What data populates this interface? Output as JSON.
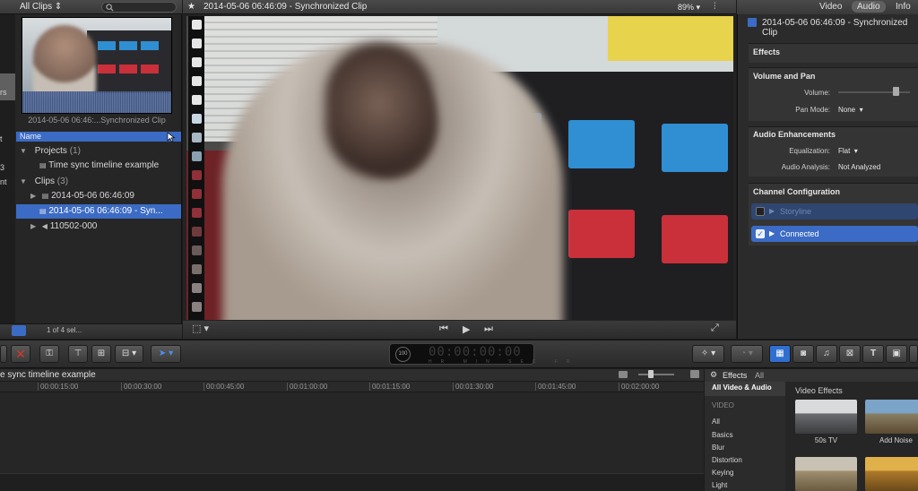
{
  "browser": {
    "filter_label": "All Clips",
    "sidebar_fragments": [
      "rs",
      "t",
      "3",
      "nt"
    ],
    "thumb_label": "2014-05-06 06:46:...Synchronized Clip",
    "column_name": "Name",
    "projects_label": "Projects",
    "projects_count": "(1)",
    "project_item": "Time sync timeline example",
    "clips_label": "Clips",
    "clips_count": "(3)",
    "clip_1": "2014-05-06 06:46:09",
    "clip_2": "2014-05-06 06:46:09 - Syn...",
    "clip_3": "110502-000",
    "selection_count": "1 of 4 sel..."
  },
  "viewer": {
    "title": "2014-05-06 06:46:09 - Synchronized Clip",
    "zoom": "89%"
  },
  "inspector": {
    "tabs": [
      "Video",
      "Audio",
      "Info"
    ],
    "title": "2014-05-06 06:46:09 - Synchronized Clip",
    "effects_header": "Effects",
    "volume_pan_header": "Volume and Pan",
    "volume_label": "Volume:",
    "pan_mode_label": "Pan Mode:",
    "pan_mode_value": "None",
    "enhancements_header": "Audio Enhancements",
    "equalization_label": "Equalization:",
    "equalization_value": "Flat",
    "analysis_label": "Audio Analysis:",
    "analysis_value": "Not Analyzed",
    "channel_header": "Channel Configuration",
    "channel_storyline": "Storyline",
    "channel_connected": "Connected"
  },
  "toolbar": {
    "timecode": "00:00:00:00",
    "timecode_units": "HR MIN SEC FR",
    "percent": "100"
  },
  "timeline": {
    "title": "e sync timeline example",
    "ticks": [
      "00:00:15:00",
      "00:00:30:00",
      "00:00:45:00",
      "00:01:00:00",
      "00:01:15:00",
      "00:01:30:00",
      "00:01:45:00",
      "00:02:00:00"
    ]
  },
  "effects": {
    "header": "Effects",
    "header_all": "All",
    "selected_category": "All Video & Audio",
    "section_label": "VIDEO",
    "categories": [
      "All",
      "Basics",
      "Blur",
      "Distortion",
      "Keying",
      "Light"
    ],
    "panel_title": "Video Effects",
    "items": [
      "50s TV",
      "Add Noise"
    ]
  },
  "colors": {
    "selection_blue": "#3b6bc4",
    "close_red": "#d33a2c",
    "panel_bg": "#262626"
  }
}
